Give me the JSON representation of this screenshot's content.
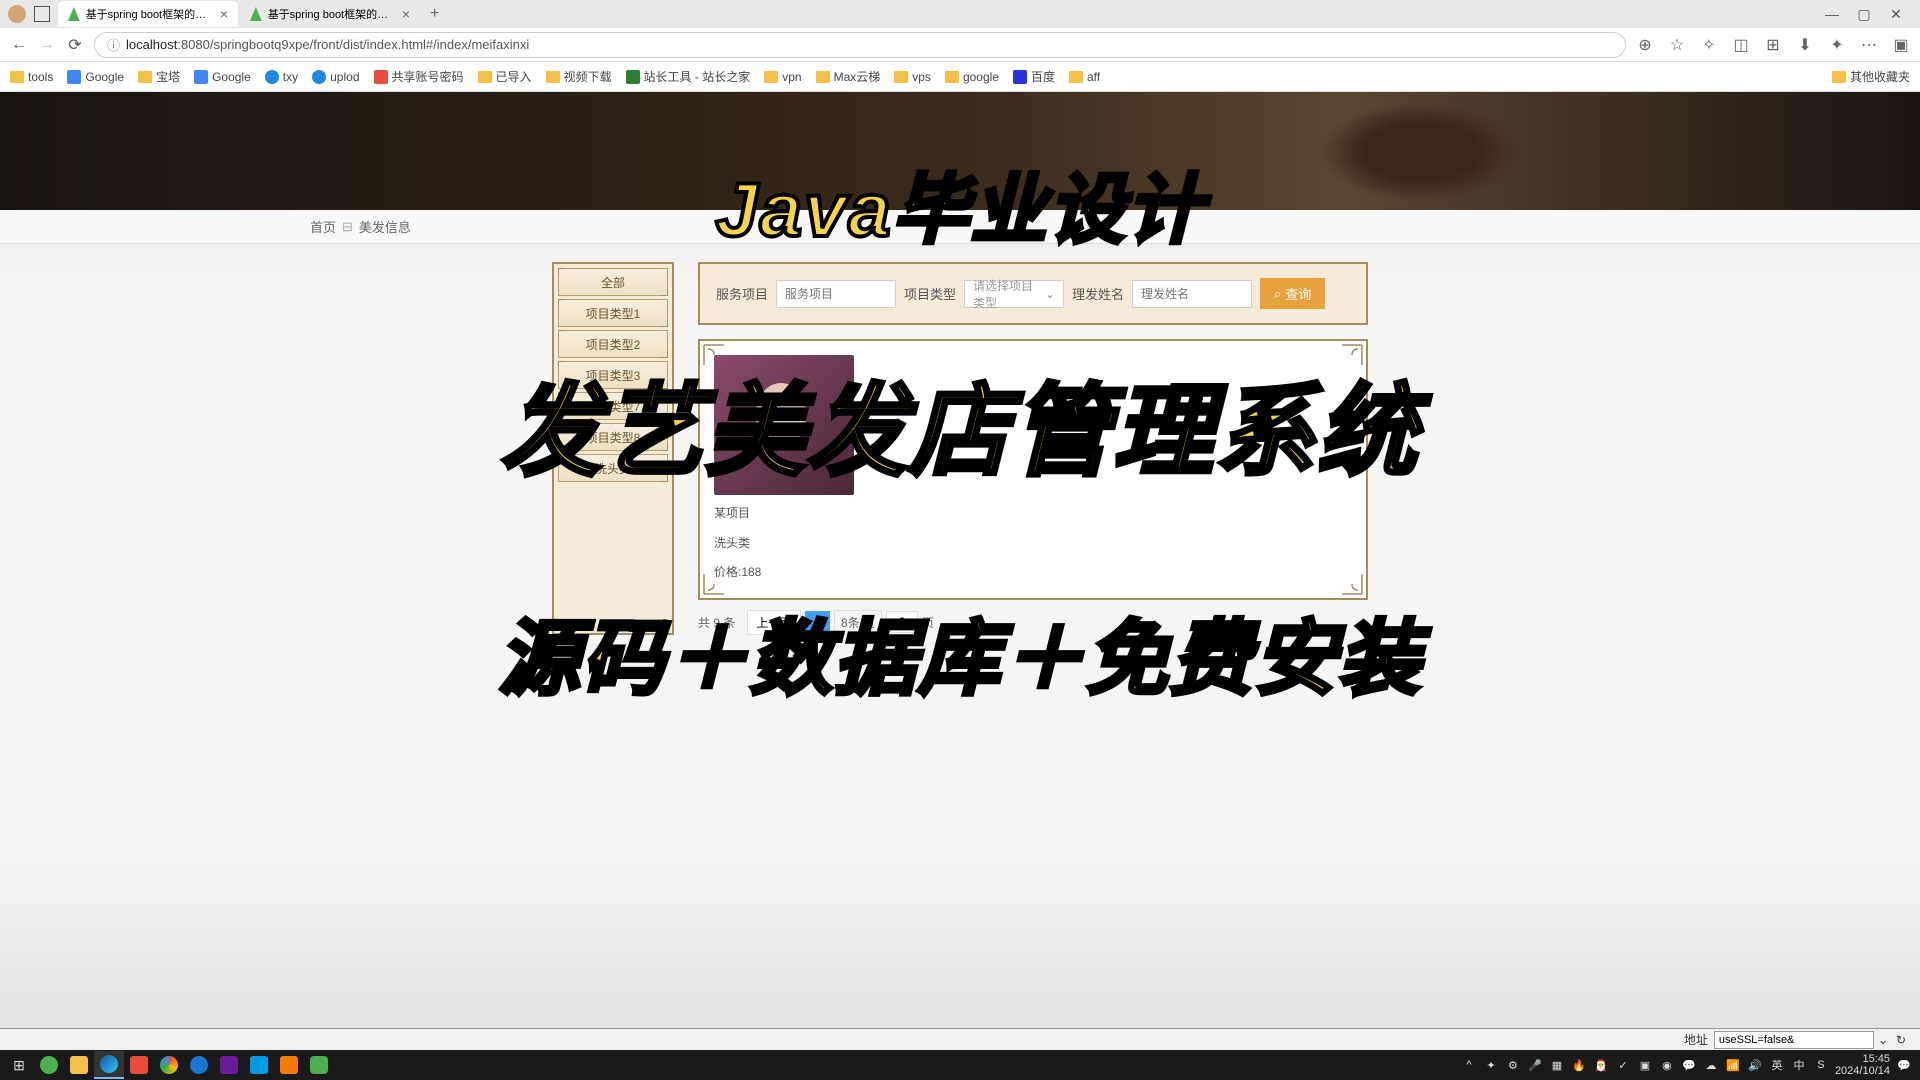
{
  "tabs": [
    {
      "title": "基于spring boot框架的发艺美发"
    },
    {
      "title": "基于spring boot框架的发艺美发"
    }
  ],
  "url": {
    "host": "localhost",
    "path": ":8080/springbootq9xpe/front/dist/index.html#/index/meifaxinxi"
  },
  "bookmarks": [
    "tools",
    "Google",
    "宝塔",
    "Google",
    "txy",
    "uplod",
    "共享账号密码",
    "已导入",
    "视频下载",
    "站长工具 - 站长之家",
    "vpn",
    "Max云梯",
    "vps",
    "google",
    "百度",
    "aff"
  ],
  "bookmarks_right": "其他收藏夹",
  "breadcrumb": {
    "home": "首页",
    "current": "美发信息"
  },
  "sidebar": [
    "全部",
    "项目类型1",
    "项目类型2",
    "项目类型3",
    "项目类型7",
    "项目类型8",
    "洗头类"
  ],
  "search": {
    "field1_label": "服务项目",
    "field1_placeholder": "服务项目",
    "field2_label": "项目类型",
    "field2_placeholder": "请选择项目类型",
    "field3_label": "理发姓名",
    "field3_placeholder": "理发姓名",
    "btn": "查询"
  },
  "card": {
    "title": "某项目",
    "category": "洗头类",
    "price": "价格:188"
  },
  "pagination": {
    "total": "共 9 条",
    "prev": "上一页",
    "page1": "1",
    "per": "8条/页",
    "jump_val": "2",
    "jump_suffix": "页"
  },
  "overlays": {
    "t1": "Java毕业设计",
    "t2": "发艺美发店管理系统",
    "t3": "源码＋数据库＋免费安装"
  },
  "statusbar": {
    "label": "地址",
    "value": "useSSL=false&"
  },
  "tray": {
    "ime1": "英",
    "ime2": "中",
    "time": "15:45",
    "date": "2024/10/14"
  }
}
